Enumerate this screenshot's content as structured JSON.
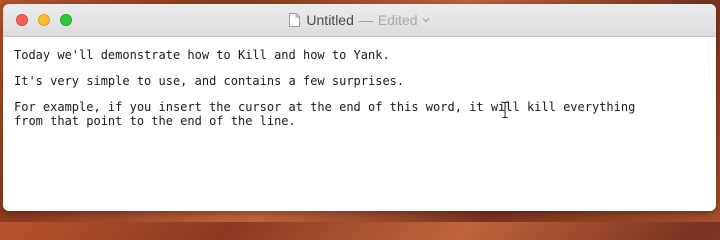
{
  "window": {
    "title": "Untitled",
    "separator": "—",
    "status": "Edited"
  },
  "document": {
    "line1": "Today we'll demonstrate how to Kill and how to Yank.",
    "line2": "It's very simple to use, and contains a few surprises.",
    "line3": "For example, if you insert the cursor at the end of this word, it will kill everything",
    "line4": "from that point to the end of the line."
  },
  "icons": {
    "document": "document-icon",
    "chevron": "chevron-down-icon",
    "cursor": "i-beam-cursor-icon"
  },
  "colors": {
    "close": "#fc5f57",
    "minimize": "#fdbc2e",
    "zoom": "#28c840"
  }
}
